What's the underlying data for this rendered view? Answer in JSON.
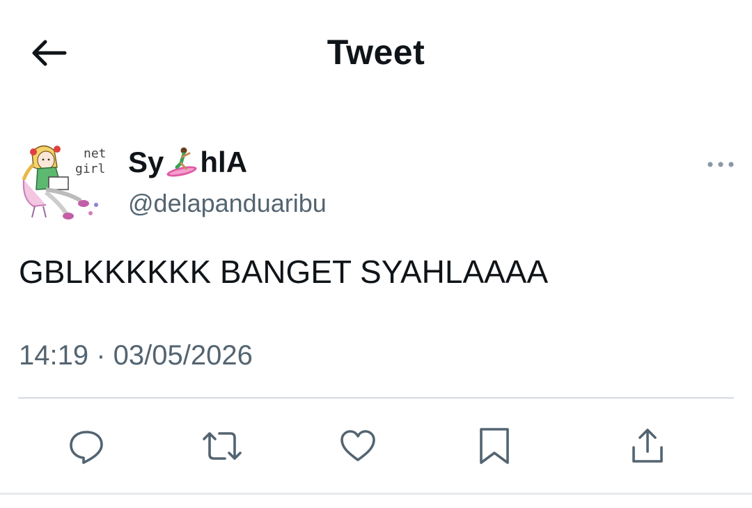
{
  "header": {
    "title": "Tweet",
    "back_icon": "arrow-left-icon"
  },
  "tweet": {
    "author": {
      "display_name_prefix": "Sy",
      "display_name_emoji": "surfer-emoji",
      "display_name_suffix": "hlA",
      "handle": "@delapanduaribu",
      "avatar_text_top": "net",
      "avatar_text_bottom": "girl"
    },
    "text": "GBLKKKKKK BANGET SYAHLAAAA",
    "timestamp": "14:19 · 03/05/2026",
    "more_icon": "more-horizontal-icon"
  },
  "actions": [
    {
      "icon": "reply-icon"
    },
    {
      "icon": "retweet-icon"
    },
    {
      "icon": "like-icon"
    },
    {
      "icon": "bookmark-icon"
    },
    {
      "icon": "share-icon"
    }
  ],
  "colors": {
    "text_primary": "#0f1419",
    "text_secondary": "#536471",
    "divider": "#d6dbdf",
    "background": "#ffffff"
  }
}
